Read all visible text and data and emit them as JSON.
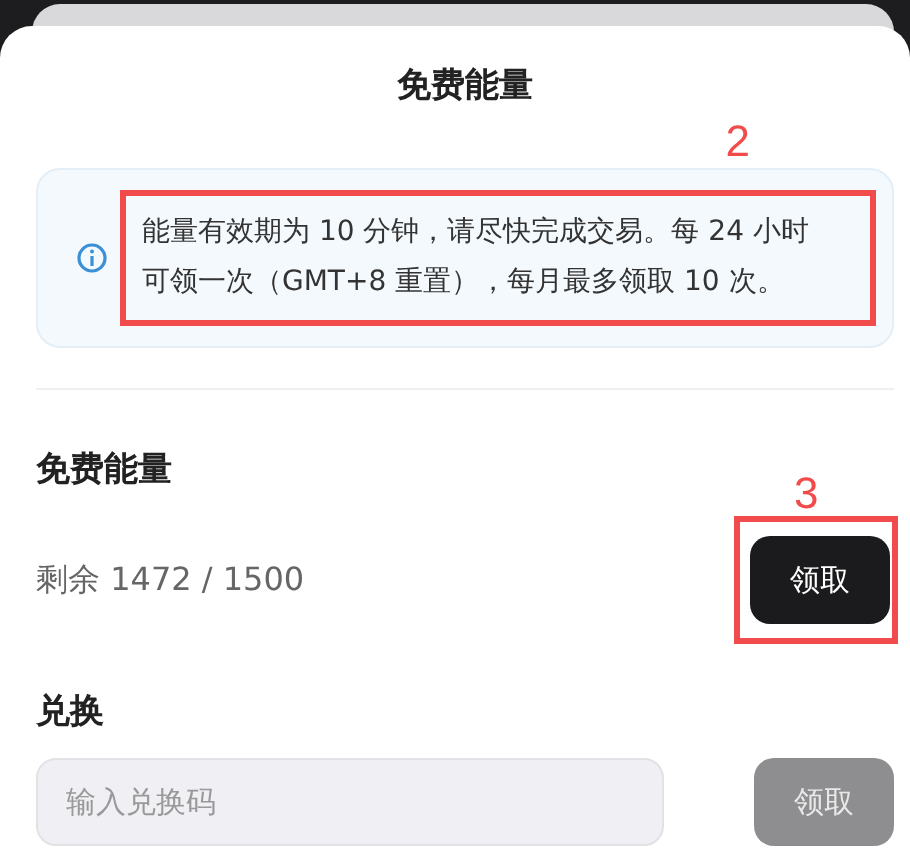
{
  "title": "免费能量",
  "notice": {
    "text": "能量有效期为 10 分钟，请尽快完成交易。每 24 小时可领一次（GMT+8 重置），每月最多领取 10 次。",
    "annotation": "2"
  },
  "free_energy": {
    "heading": "免费能量",
    "remaining": "剩余 1472 / 1500",
    "button": {
      "label": "领取",
      "disabled": false
    },
    "annotation": "3"
  },
  "redeem": {
    "heading": "兑换",
    "placeholder": "输入兑换码",
    "button": {
      "label": "领取",
      "disabled": true
    }
  }
}
